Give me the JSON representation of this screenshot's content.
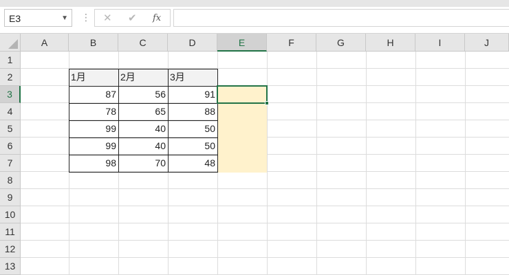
{
  "name_box": {
    "value": "E3"
  },
  "formula_bar": {
    "cancel": "✕",
    "enter": "✔",
    "fx": "fx",
    "value": ""
  },
  "columns": [
    "A",
    "B",
    "C",
    "D",
    "E",
    "F",
    "G",
    "H",
    "I",
    "J"
  ],
  "selected_column": "E",
  "rows": [
    "1",
    "2",
    "3",
    "4",
    "5",
    "6",
    "7",
    "8",
    "9",
    "10",
    "11",
    "12",
    "13"
  ],
  "selected_row": "3",
  "table": {
    "headers": [
      "1月",
      "2月",
      "3月"
    ],
    "data": [
      [
        "87",
        "56",
        "91"
      ],
      [
        "78",
        "65",
        "88"
      ],
      [
        "99",
        "40",
        "50"
      ],
      [
        "99",
        "40",
        "50"
      ],
      [
        "98",
        "70",
        "48"
      ]
    ]
  },
  "colors": {
    "selection_accent": "#217346",
    "highlight_fill": "#fff2cc",
    "header_fill": "#f2f2f2"
  }
}
